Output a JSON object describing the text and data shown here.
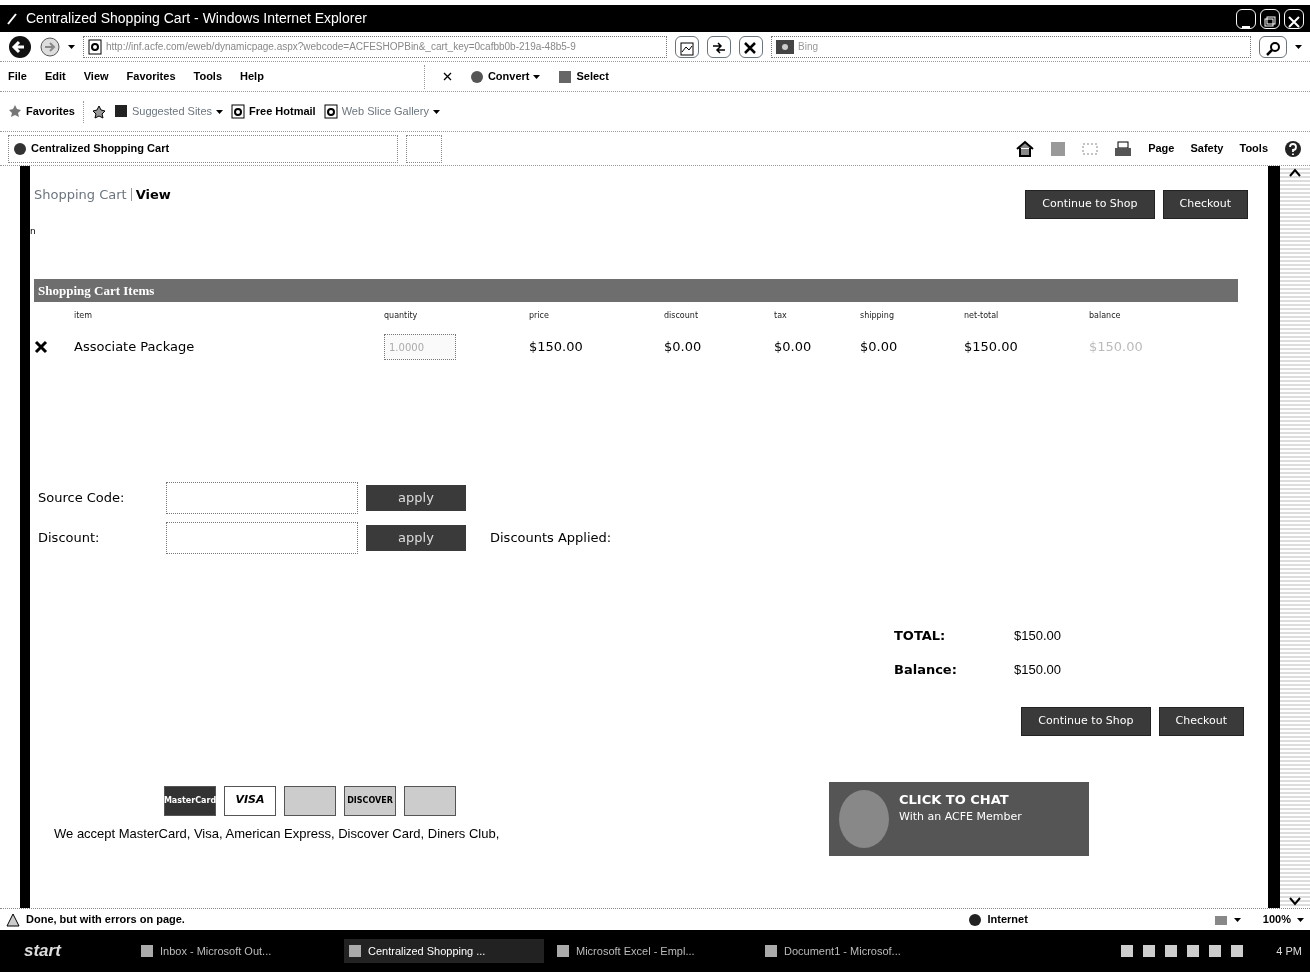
{
  "window": {
    "title": "Centralized Shopping Cart - Windows Internet Explorer"
  },
  "address_bar": {
    "url": "http://inf.acfe.com/eweb/dynamicpage.aspx?webcode=ACFESHOPBin&_cart_key=0cafbb0b-219a-48b5-9",
    "search_placeholder": "Bing"
  },
  "menu": [
    "File",
    "Edit",
    "View",
    "Favorites",
    "Tools",
    "Help"
  ],
  "toolbar": [
    {
      "label": "Convert",
      "dropdown": true
    },
    {
      "label": "Select",
      "dropdown": false
    }
  ],
  "favorites_bar": [
    {
      "label": "Favorites",
      "kind": "favorites",
      "dropdown": false,
      "dim": false
    },
    {
      "label": "Suggested Sites",
      "kind": "site",
      "dropdown": true,
      "dim": true
    },
    {
      "label": "Free Hotmail",
      "kind": "page",
      "dropdown": false,
      "dim": false
    },
    {
      "label": "Web Slice Gallery",
      "kind": "page",
      "dropdown": true,
      "dim": true
    }
  ],
  "tabs": [
    {
      "label": "Centralized Shopping Cart",
      "selected": true
    }
  ],
  "command_bar": [
    "Page",
    "Safety",
    "Tools"
  ],
  "page": {
    "breadcrumb": [
      "Shopping Cart",
      "View"
    ],
    "stray_text": "n",
    "top_buttons": [
      "Continue to Shop",
      "Checkout"
    ],
    "section_title": "Shopping Cart Items",
    "columns": [
      "item",
      "quantity",
      "price",
      "discount",
      "tax",
      "shipping",
      "net-total",
      "balance"
    ],
    "rows": [
      {
        "item": "Associate Package",
        "quantity": "1.0000",
        "quantity_disabled": true,
        "price": "$150.00",
        "discount": "$0.00",
        "tax": "$0.00",
        "shipping": "$0.00",
        "net_total": "$150.00",
        "balance": "$150.00",
        "balance_disabled": true
      }
    ],
    "codes": [
      {
        "label": "Source Code:",
        "button": "apply"
      },
      {
        "label": "Discount:",
        "button": "apply"
      }
    ],
    "discounts_applied": "Discounts Applied:",
    "totals": [
      {
        "label": "TOTAL:",
        "value": "$150.00"
      },
      {
        "label": "Balance:",
        "value": "$150.00"
      }
    ],
    "bottom_buttons": [
      "Continue to Shop",
      "Checkout"
    ],
    "cards": [
      {
        "label": "MasterCard",
        "kind": "mastercard"
      },
      {
        "label": "VISA",
        "kind": "visa"
      },
      {
        "kind": "amex"
      },
      {
        "label": "DISCOVER",
        "kind": "discover"
      },
      {
        "kind": "diners"
      }
    ],
    "accept_text": "We accept MasterCard, Visa, American Express, Discover Card, Diners Club,",
    "chat": {
      "title": "CLICK TO CHAT",
      "subtitle": "With an ACFE Member"
    }
  },
  "status_bar": {
    "message": "Done, but with errors on page.",
    "zone": "Internet",
    "zoom": "100%"
  },
  "taskbar": {
    "start": "start",
    "items": [
      {
        "label": "Inbox - Microsoft Out...",
        "selected": false
      },
      {
        "label": "Centralized Shopping ...",
        "selected": true
      },
      {
        "label": "Microsoft Excel - Empl...",
        "selected": false
      },
      {
        "label": "Document1 - Microsof...",
        "selected": false
      }
    ],
    "clock": "4 PM"
  }
}
